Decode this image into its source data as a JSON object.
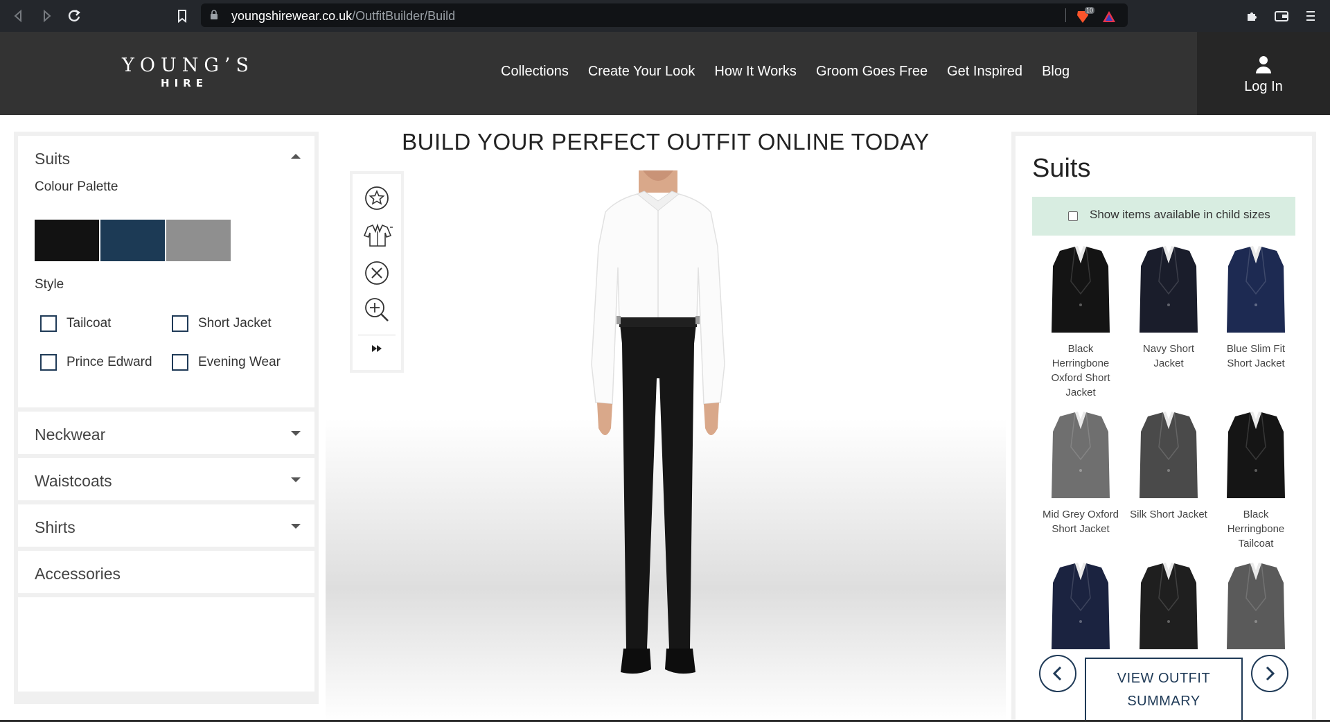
{
  "browser": {
    "url_domain": "youngshirewear.co.uk",
    "url_path": "/OutfitBuilder/Build",
    "brave_badge": "10"
  },
  "header": {
    "logo_main": "YOUNG’S",
    "logo_sub": "HIRE",
    "nav": [
      "Collections",
      "Create Your Look",
      "How It Works",
      "Groom Goes Free",
      "Get Inspired",
      "Blog"
    ],
    "login_label": "Log In"
  },
  "filters": {
    "suits_title": "Suits",
    "colour_palette_label": "Colour Palette",
    "colours": [
      "#121212",
      "#1c3a55",
      "#8f8f8f"
    ],
    "style_label": "Style",
    "styles": [
      "Tailcoat",
      "Short Jacket",
      "Prince Edward",
      "Evening Wear"
    ],
    "sections": [
      "Neckwear",
      "Waistcoats",
      "Shirts",
      "Accessories"
    ]
  },
  "stage": {
    "title": "BUILD YOUR PERFECT OUTFIT ONLINE TODAY",
    "tools": [
      "star-icon",
      "jacket-icon",
      "close-circle-icon",
      "zoom-in-icon",
      "fast-forward-icon"
    ]
  },
  "products": {
    "title": "Suits",
    "child_sizes_label": "Show items available in child sizes",
    "items": [
      {
        "name": "Black Herringbone Oxford Short Jacket",
        "color": "#141414"
      },
      {
        "name": "Navy Short Jacket",
        "color": "#1a1d2b"
      },
      {
        "name": "Blue Slim Fit Short Jacket",
        "color": "#1d2a52"
      },
      {
        "name": "Mid Grey Oxford Short Jacket",
        "color": "#6f6f6f"
      },
      {
        "name": "Silk Short Jacket",
        "color": "#4a4a4a"
      },
      {
        "name": "Black Herringbone Tailcoat",
        "color": "#151515"
      },
      {
        "name": "",
        "color": "#1b2340"
      },
      {
        "name": "",
        "color": "#1f1f1f"
      },
      {
        "name": "",
        "color": "#5a5a5a"
      }
    ],
    "summary_button": "VIEW OUTFIT SUMMARY"
  }
}
